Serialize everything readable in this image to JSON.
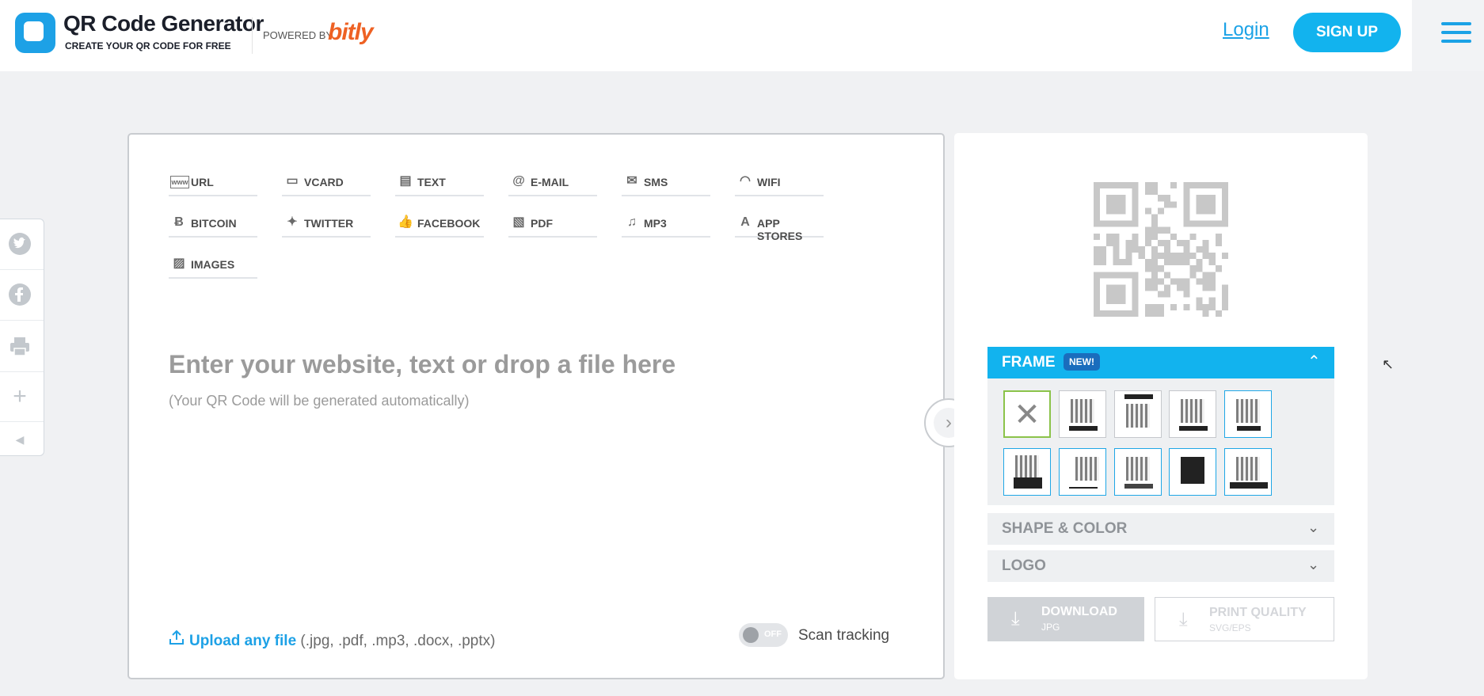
{
  "header": {
    "logo_title": "QR Code Generator",
    "logo_subtitle": "CREATE YOUR QR CODE FOR FREE",
    "powered_by": "POWERED BY",
    "brand": "bitly",
    "login": "Login",
    "signup": "SIGN UP"
  },
  "tabs": [
    {
      "label": "URL",
      "icon": "www-icon"
    },
    {
      "label": "VCARD",
      "icon": "vcard-icon"
    },
    {
      "label": "TEXT",
      "icon": "text-document-icon"
    },
    {
      "label": "E-MAIL",
      "icon": "at-icon"
    },
    {
      "label": "SMS",
      "icon": "sms-icon"
    },
    {
      "label": "WIFI",
      "icon": "wifi-icon"
    },
    {
      "label": "BITCOIN",
      "icon": "bitcoin-icon"
    },
    {
      "label": "TWITTER",
      "icon": "twitter-icon"
    },
    {
      "label": "FACEBOOK",
      "icon": "thumbs-up-icon"
    },
    {
      "label": "PDF",
      "icon": "pdf-icon"
    },
    {
      "label": "MP3",
      "icon": "music-note-icon"
    },
    {
      "label": "APP STORES",
      "icon": "app-store-icon"
    },
    {
      "label": "IMAGES",
      "icon": "image-icon"
    }
  ],
  "main": {
    "prompt": "Enter your website, text or drop a file here",
    "prompt_sub": "(Your QR Code will be generated automatically)",
    "upload_link": "Upload any file",
    "upload_types": "(.jpg, .pdf, .mp3, .docx, .pptx)",
    "toggle_state": "OFF",
    "scan_tracking": "Scan tracking"
  },
  "panel": {
    "frame_title": "FRAME",
    "frame_badge": "NEW!",
    "shape_color": "SHAPE & COLOR",
    "logo": "LOGO",
    "download_label": "DOWNLOAD",
    "download_format": "JPG",
    "print_label": "PRINT QUALITY",
    "print_format": "SVG/EPS"
  },
  "colors": {
    "accent": "#12b3ee",
    "link": "#1da1e6",
    "brand_orange": "#ee6123",
    "badge": "#1a6dbd"
  }
}
